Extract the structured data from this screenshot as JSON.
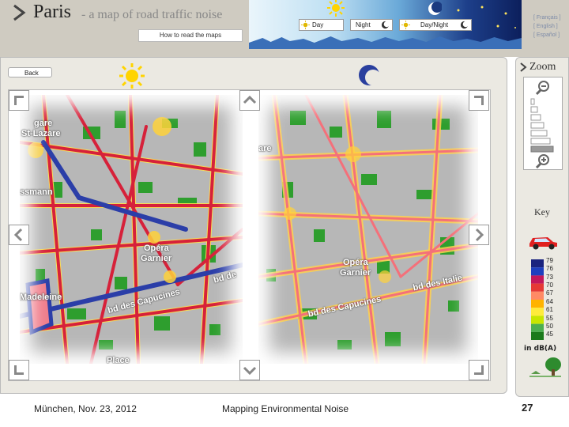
{
  "header": {
    "title": "Paris",
    "subtitle": "- a map of road traffic noise",
    "howto_label": "How to read the maps",
    "modes": {
      "day": "Day",
      "night": "Night",
      "daynight": "Day/Night"
    },
    "languages": [
      "[ Français ]",
      "[ English ]",
      "[ Español ]"
    ]
  },
  "main": {
    "back_label": "Back",
    "day_map_labels": [
      "gare",
      "St-Lazare",
      "ssmann",
      "Opéra",
      "Garnier",
      "bd de",
      "Madeleine",
      "bd des Capucines",
      "Place"
    ],
    "night_map_labels": [
      "are",
      "Opéra",
      "Garnier",
      "bd des Italie",
      "bd des Capucines"
    ]
  },
  "right": {
    "zoom_label": "Zoom",
    "key_label": "Key",
    "legend_ticks": [
      "79",
      "76",
      "73",
      "70",
      "67",
      "64",
      "61",
      "55",
      "50",
      "45"
    ],
    "legend_colors": [
      "#1a237e",
      "#1e3fbf",
      "#c2185b",
      "#e53935",
      "#ff8a65",
      "#ffb300",
      "#ffeb3b",
      "#c8e600",
      "#4caf50",
      "#1b7a1b"
    ],
    "unit": "in dB(A)"
  },
  "footer": {
    "date": "München, Nov. 23, 2012",
    "title": "Mapping Environmental Noise",
    "page": "27"
  }
}
